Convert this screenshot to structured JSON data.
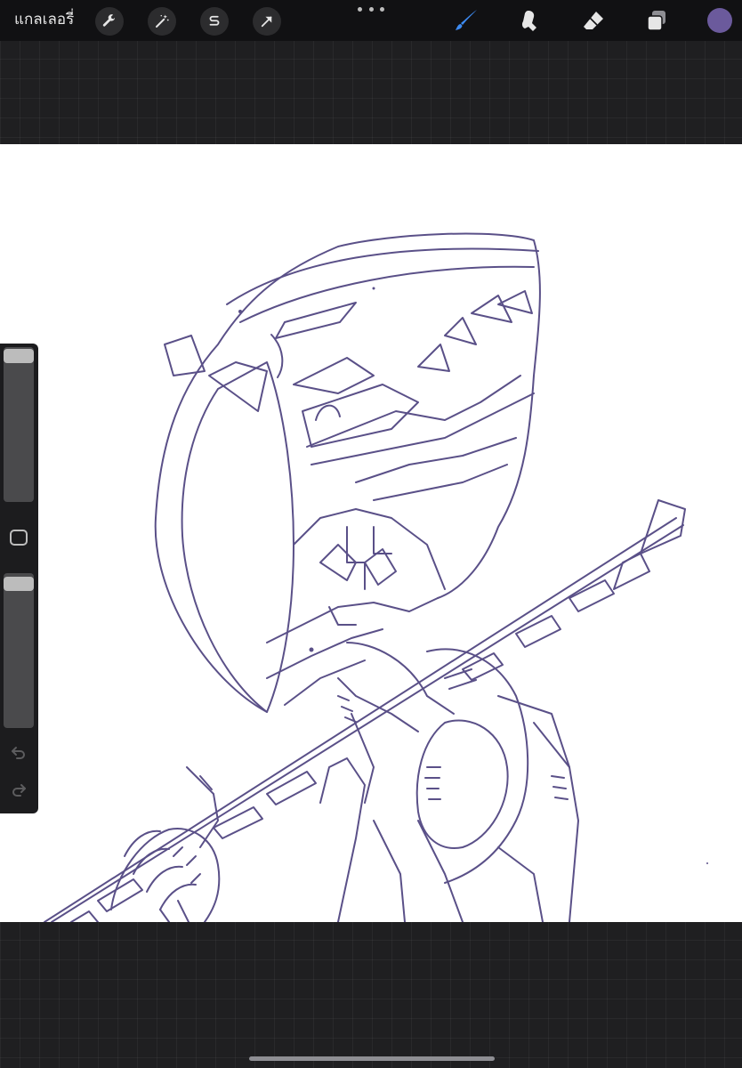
{
  "topbar": {
    "gallery_label": "แกลเลอรี่",
    "actions_icon": "wrench-icon",
    "adjustments_icon": "magic-wand-icon",
    "selection_icon": "selection-s-icon",
    "transform_icon": "arrow-cursor-icon",
    "more_icon": "ellipsis-icon",
    "brush_icon": "brush-icon",
    "smudge_icon": "smudge-icon",
    "eraser_icon": "eraser-icon",
    "layers_icon": "layers-icon"
  },
  "colors": {
    "active_tool": "#3d8bf2",
    "current_color": "#6b5a9c",
    "ink": "#5a5088"
  },
  "sidebar": {
    "brush_size_level": 0.0,
    "opacity_level": 0.0,
    "undo_icon": "undo-icon",
    "redo_icon": "redo-icon",
    "modify_icon": "square-modify-icon"
  },
  "canvas": {
    "artwork": "line-art-sketch"
  }
}
